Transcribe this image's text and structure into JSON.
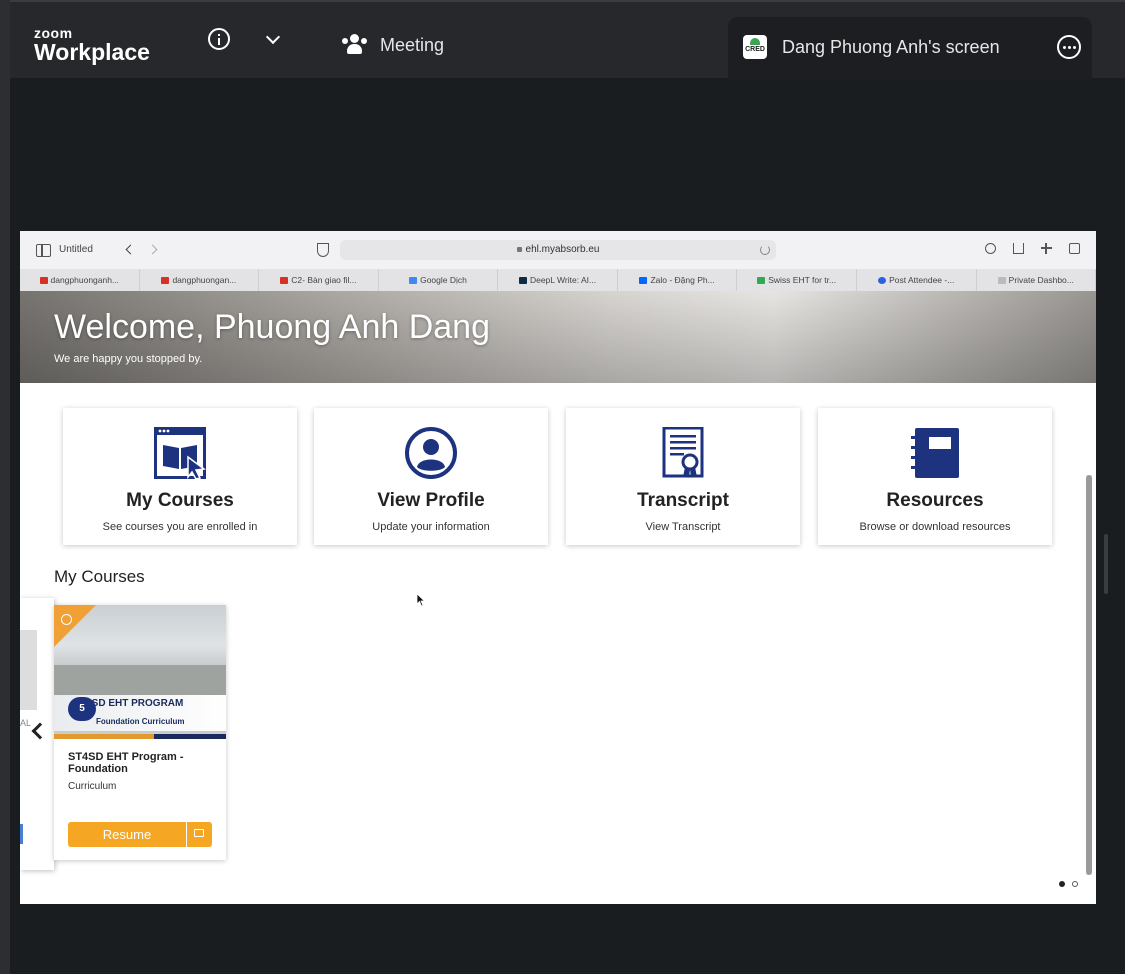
{
  "zoom": {
    "logo_top": "zoom",
    "logo_bottom": "Workplace",
    "meeting_label": "Meeting",
    "share_label": "Dang Phuong Anh's screen",
    "share_icon_text": "CRED"
  },
  "browser": {
    "tab_group": "Untitled",
    "url": "ehl.myabsorb.eu",
    "tabs": [
      {
        "label": "dangphuonganh...",
        "icon_color": "#d93025"
      },
      {
        "label": "dangphuongan...",
        "icon_color": "#d93025"
      },
      {
        "label": "C2- Bàn giao fil...",
        "icon_color": "#d93025"
      },
      {
        "label": "Google Dịch",
        "icon_color": "#4285f4"
      },
      {
        "label": "DeepL Write: AI...",
        "icon_color": "#0f2b46"
      },
      {
        "label": "Zalo - Đặng Ph...",
        "icon_color": "#0068ff"
      },
      {
        "label": "Swiss EHT for tr...",
        "icon_color": "#34a853"
      },
      {
        "label": "Post Attendee -...",
        "icon_color": "#2d5fe0"
      },
      {
        "label": "Private Dashbo...",
        "icon_color": "#bbbbbb"
      }
    ]
  },
  "page": {
    "welcome_title": "Welcome, Phuong Anh Dang",
    "welcome_sub": "We are happy you stopped by.",
    "cards": [
      {
        "title": "My Courses",
        "sub": "See courses you are enrolled in"
      },
      {
        "title": "View Profile",
        "sub": "Update your information"
      },
      {
        "title": "Transcript",
        "sub": "View Transcript"
      },
      {
        "title": "Resources",
        "sub": "Browse or download resources"
      }
    ],
    "my_courses_heading": "My Courses",
    "peek_text": "AL",
    "course": {
      "badge": "5",
      "image_title": "T4SD EHT PROGRAM",
      "image_sub": "Foundation Curriculum",
      "title": "ST4SD EHT Program - Foundation",
      "subtitle": "Curriculum",
      "resume_label": "Resume"
    }
  },
  "colors": {
    "brand_navy": "#1d3380",
    "resume_orange": "#f5a623"
  }
}
